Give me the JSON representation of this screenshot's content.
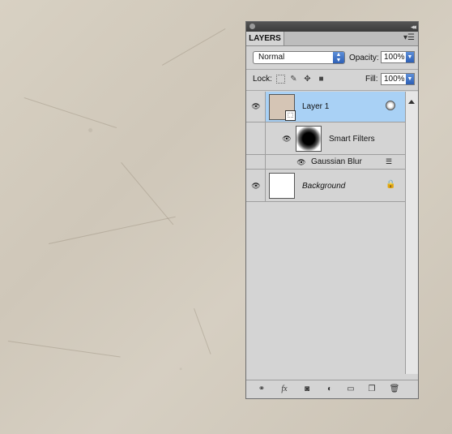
{
  "panel": {
    "tab_label": "LAYERS",
    "blend_mode": "Normal",
    "opacity_label": "Opacity:",
    "opacity_value": "100%",
    "lock_label": "Lock:",
    "fill_label": "Fill:",
    "fill_value": "100%"
  },
  "layers": [
    {
      "name": "Layer 1",
      "selected": true
    },
    {
      "name": "Smart Filters"
    },
    {
      "name": "Gaussian Blur"
    },
    {
      "name": "Background",
      "italic": true
    }
  ],
  "colors": {
    "selection": "#a9d1f5",
    "accent_blue": "#2d5fb5"
  },
  "icons": [
    "link-icon",
    "fx-icon",
    "layer-mask-icon",
    "adjustment-layer-icon",
    "folder-icon",
    "new-layer-icon",
    "trash-icon"
  ]
}
